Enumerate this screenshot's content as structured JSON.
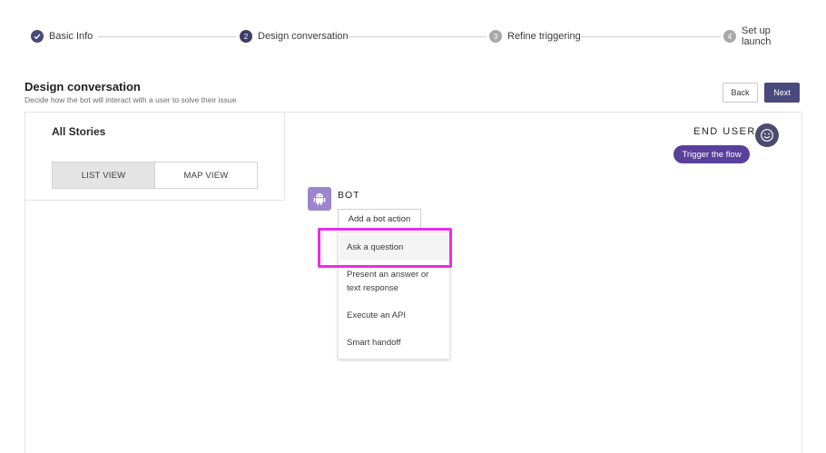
{
  "stepper": {
    "steps": [
      {
        "number": "✓",
        "label": "Basic Info",
        "state": "done"
      },
      {
        "number": "2",
        "label": "Design conversation",
        "state": "active"
      },
      {
        "number": "3",
        "label": "Refine triggering",
        "state": "todo"
      },
      {
        "number": "4",
        "label": "Set up launch",
        "state": "todo"
      }
    ]
  },
  "header": {
    "title": "Design conversation",
    "subtitle": "Decide how the bot will interact with a user to solve their issue",
    "back_label": "Back",
    "next_label": "Next"
  },
  "stories": {
    "title": "All Stories",
    "views": [
      {
        "label": "LIST VIEW",
        "selected": true
      },
      {
        "label": "MAP VIEW",
        "selected": false
      }
    ]
  },
  "end_user": {
    "label": "END USER",
    "icon": "smiley-icon",
    "trigger_label": "Trigger the flow"
  },
  "bot": {
    "label": "BOT",
    "icon": "android-robot-icon",
    "add_action_label": "Add a bot action",
    "menu": [
      "Ask a question",
      "Present an answer or text response",
      "Execute an API",
      "Smart handoff"
    ]
  },
  "colors": {
    "primary": "#4b4a7e",
    "trigger": "#5b3f9c",
    "bot_avatar": "#9b86cf",
    "highlight": "#ea2ce8"
  }
}
